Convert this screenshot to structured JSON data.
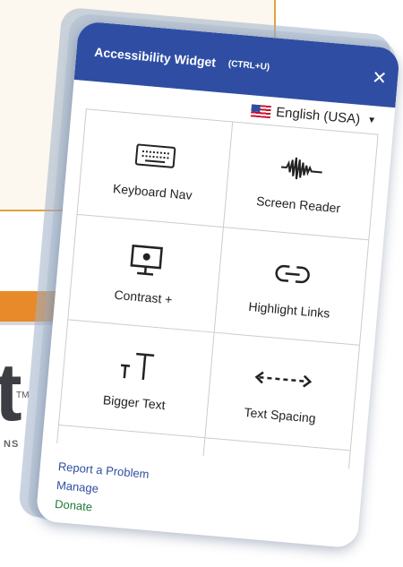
{
  "widget": {
    "title": "Accessibility Widget",
    "shortcut": "(CTRL+U)",
    "close_icon": "close-icon",
    "language": "English (USA)",
    "tiles": [
      {
        "label": "Keyboard Nav",
        "icon": "keyboard-icon"
      },
      {
        "label": "Screen Reader",
        "icon": "soundwave-icon"
      },
      {
        "label": "Contrast +",
        "icon": "monitor-icon"
      },
      {
        "label": "Highlight Links",
        "icon": "link-icon"
      },
      {
        "label": "Bigger Text",
        "icon": "text-size-icon"
      },
      {
        "label": "Text Spacing",
        "icon": "text-spacing-icon"
      }
    ],
    "footer": {
      "report": "Report a Problem",
      "manage": "Manage",
      "donate": "Donate"
    }
  },
  "background": {
    "logo_letter": "t",
    "trademark": "TM",
    "subtext": "NS"
  },
  "colors": {
    "header": "#2f4ea3",
    "donate": "#1f7a3a",
    "accent_orange": "#e8892a"
  }
}
